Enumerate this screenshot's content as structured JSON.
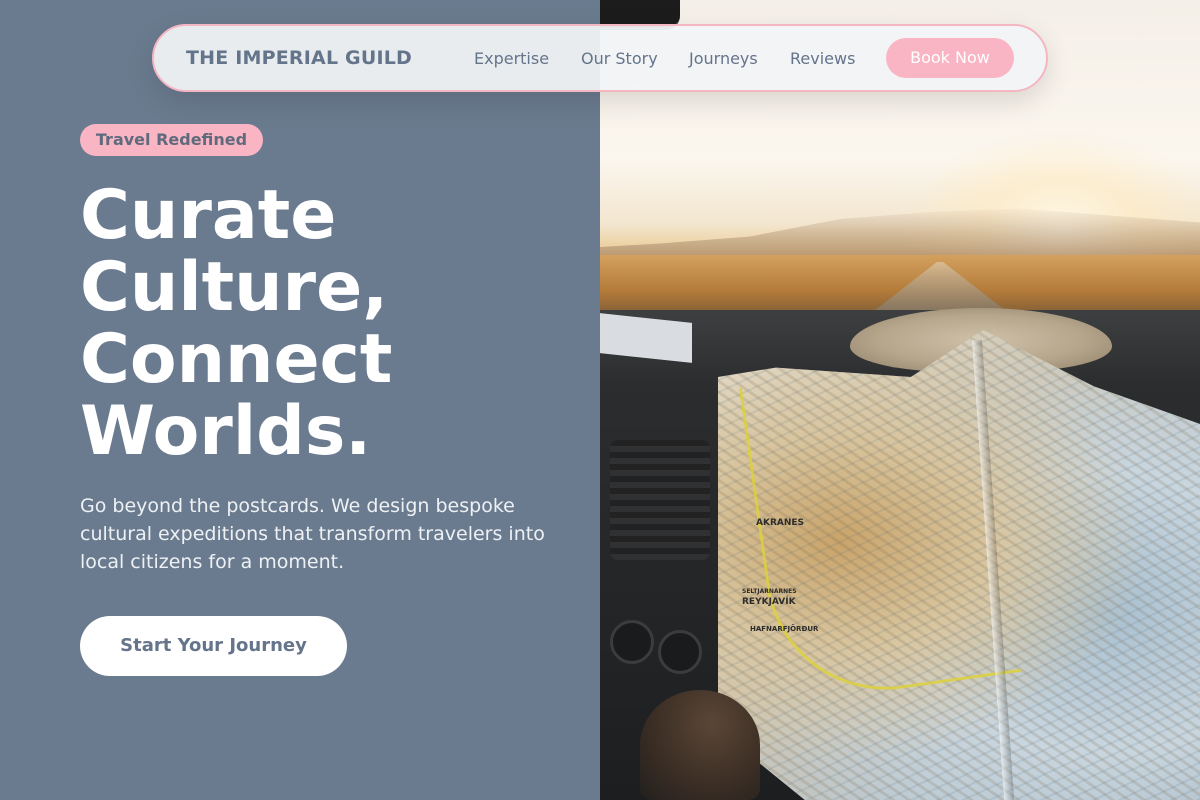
{
  "brand": {
    "name": "THE IMPERIAL GUILD"
  },
  "nav": {
    "links": [
      "Expertise",
      "Our Story",
      "Journeys",
      "Reviews"
    ],
    "cta_label": "Book Now"
  },
  "hero": {
    "badge": "Travel Redefined",
    "headline_lines": [
      "Curate",
      "Culture,",
      "Connect",
      "Worlds."
    ],
    "subtext": "Go beyond the postcards. We design bespoke cultural expeditions that transform travelers into local citizens for a moment.",
    "cta_label": "Start Your Journey"
  },
  "image": {
    "description_icon": "map-photo",
    "map_labels": [
      "AKRANES",
      "REYKJAVÍK",
      "HAFNARFJÖRÐUR",
      "SELTJARNARNES"
    ]
  },
  "colors": {
    "panel": "#6b7b8f",
    "accent_pink": "#f9b5c4",
    "text_slate": "#64748b",
    "nav_border": "#f4b6c3"
  }
}
